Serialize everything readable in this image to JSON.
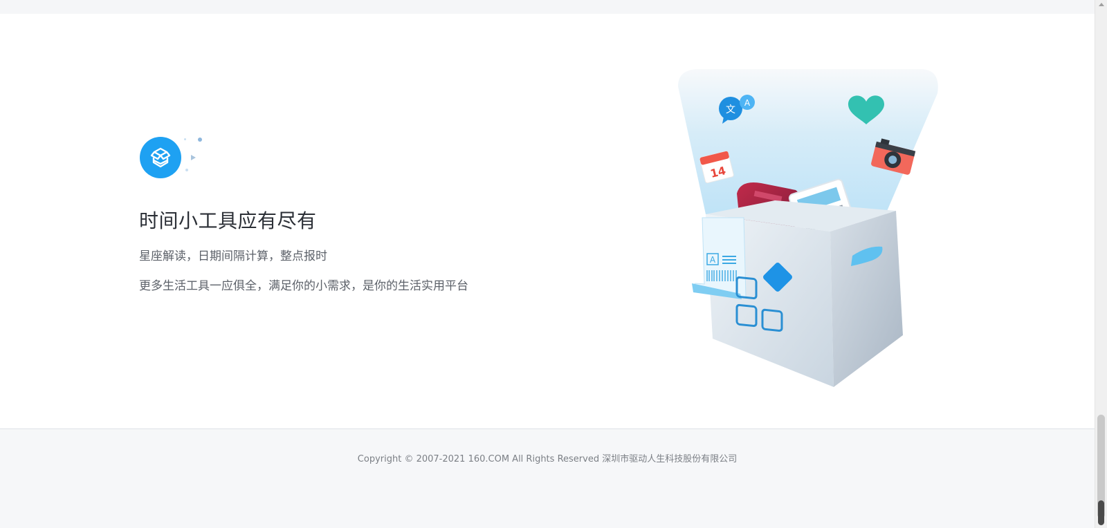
{
  "hero": {
    "title": "时间小工具应有尽有",
    "line1": "星座解读，日期间隔计算，整点报时",
    "line2": "更多生活工具一应俱全，满足你的小需求，是你的生活实用平台",
    "icon": "open-box-icon",
    "accent_color": "#1ea1f2"
  },
  "illustration": {
    "calendar_day": "14",
    "translate_glyph_left": "文",
    "translate_glyph_right": "A",
    "label_letter": "A"
  },
  "footer": {
    "copyright": "Copyright © 2007-2021 160.COM All Rights Reserved 深圳市驱动人生科技股份有限公司"
  }
}
